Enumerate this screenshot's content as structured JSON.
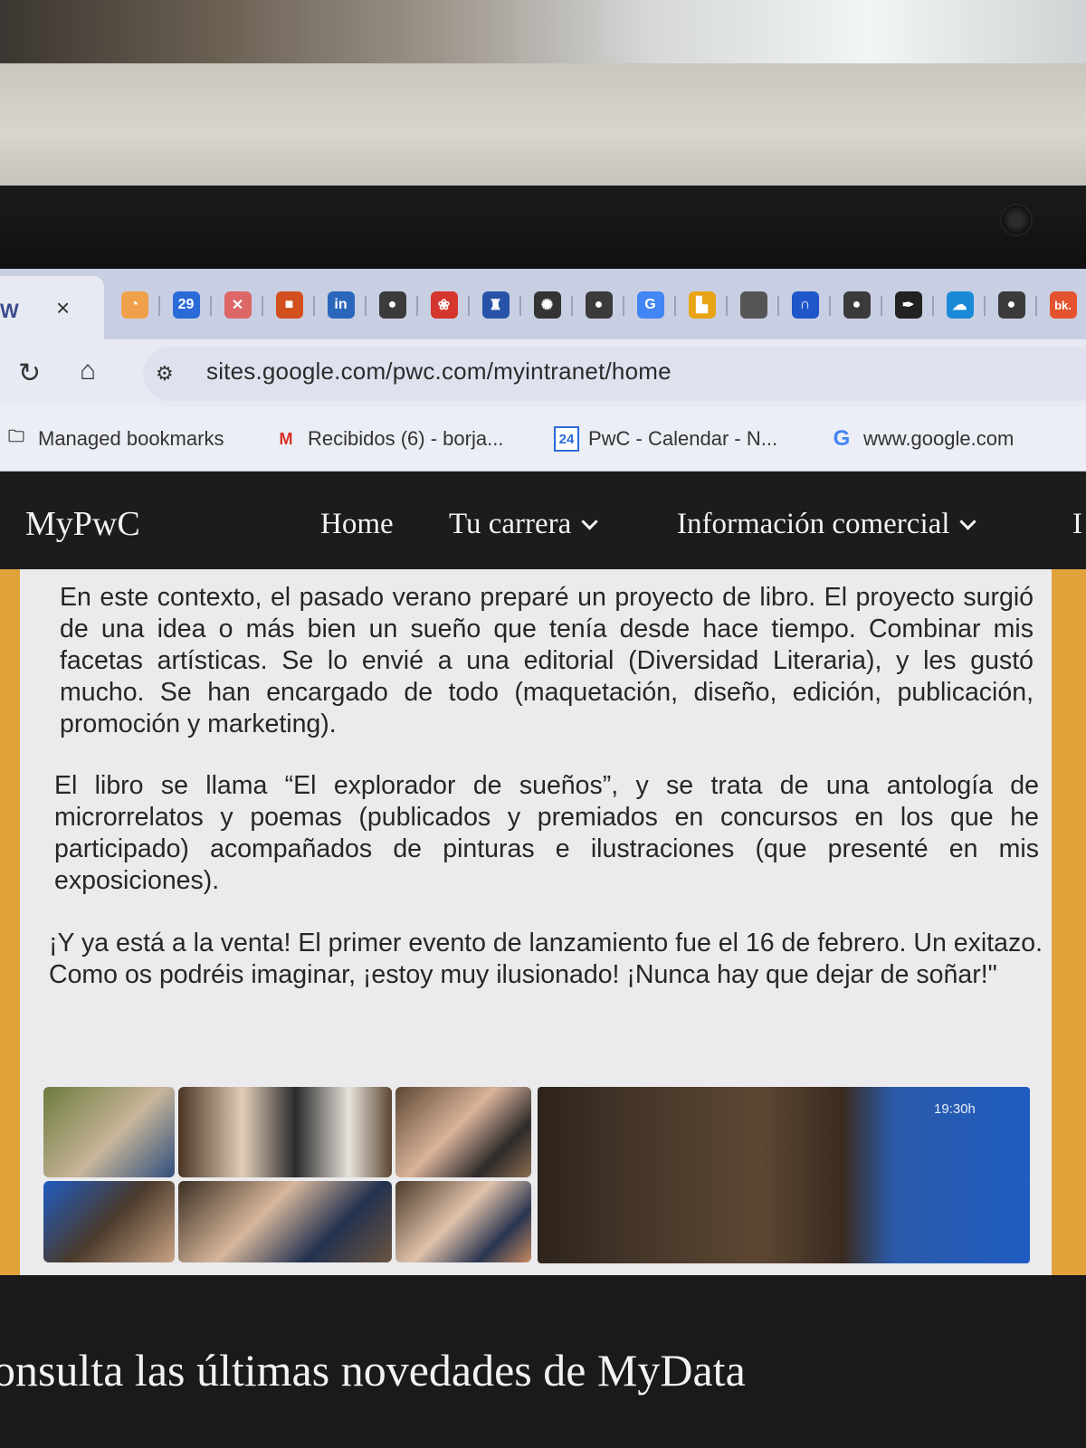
{
  "browser": {
    "tab_close": "×",
    "pinned": [
      {
        "icon": "toggl-icon",
        "glyph": "◔",
        "color": "#f0a04b"
      },
      {
        "icon": "calendar-icon",
        "glyph": "29",
        "color": "#2a6bd8"
      },
      {
        "icon": "tools-icon",
        "glyph": "✕",
        "color": "#d66"
      },
      {
        "icon": "office-icon",
        "glyph": "■",
        "color": "#d2501d"
      },
      {
        "icon": "linkedin-icon",
        "glyph": "in",
        "color": "#2a66bc"
      },
      {
        "icon": "globe-icon",
        "glyph": "●",
        "color": "#3b3b3b"
      },
      {
        "icon": "app-icon",
        "glyph": "❀",
        "color": "#d5362d"
      },
      {
        "icon": "madrid-icon",
        "glyph": "♜",
        "color": "#2754a8"
      },
      {
        "icon": "seal-icon",
        "glyph": "✺",
        "color": "#333333"
      },
      {
        "icon": "globe-icon",
        "glyph": "●",
        "color": "#3b3b3b"
      },
      {
        "icon": "google-icon",
        "glyph": "G",
        "color": "#4285f4"
      },
      {
        "icon": "analytics-icon",
        "glyph": "▙",
        "color": "#e8a317"
      },
      {
        "icon": "apple-icon",
        "glyph": "",
        "color": "#555555"
      },
      {
        "icon": "headset-icon",
        "glyph": "∩",
        "color": "#1f56c9"
      },
      {
        "icon": "globe-icon",
        "glyph": "●",
        "color": "#3b3b3b"
      },
      {
        "icon": "pen-icon",
        "glyph": "✒",
        "color": "#222222"
      },
      {
        "icon": "salesforce-icon",
        "glyph": "☁",
        "color": "#1a8ad8"
      },
      {
        "icon": "globe-icon",
        "glyph": "●",
        "color": "#3b3b3b"
      },
      {
        "icon": "bk-icon",
        "glyph": "bk.",
        "color": "#e3532d"
      }
    ],
    "url": "sites.google.com/pwc.com/myintranet/home",
    "bookmarks": [
      {
        "label": "Managed bookmarks",
        "icon": "folder-icon"
      },
      {
        "label": "Recibidos (6) - borja...",
        "icon": "gmail-icon"
      },
      {
        "label": "PwC - Calendar - N...",
        "icon": "calendar-icon",
        "badge": "24"
      },
      {
        "label": "www.google.com",
        "icon": "google-icon"
      }
    ]
  },
  "site": {
    "brand": "MyPwC",
    "nav": [
      {
        "label": "Home"
      },
      {
        "label": "Tu carrera"
      },
      {
        "label": "Información comercial"
      },
      {
        "label": "I"
      }
    ]
  },
  "article": {
    "paragraphs": [
      "En este contexto, el pasado verano preparé un proyecto de libro. El proyecto surgió de una idea o más bien un sueño que tenía desde hace tiempo. Combinar mis facetas artísticas. Se lo envié a una editorial (Diversidad Literaria), y les gustó mucho. Se han encargado de todo (maquetación, diseño, edición, publicación, promoción y marketing).",
      "El libro se llama “El explorador de sueños”, y se trata de una antología de microrrelatos y poemas (publicados y premiados en concursos en los que he participado) acompañados de pinturas e ilustraciones (que presenté en mis exposiciones).",
      "¡Y ya está a la venta! El primer evento de lanzamiento fue el 16 de febrero. Un exitazo. Como os podréis imaginar, ¡estoy muy ilusionado! ¡Nunca hay que dejar de soñar!\""
    ],
    "photo_screen_time": "19:30h"
  },
  "footer": {
    "heading": "onsulta las últimas novedades de MyData"
  }
}
